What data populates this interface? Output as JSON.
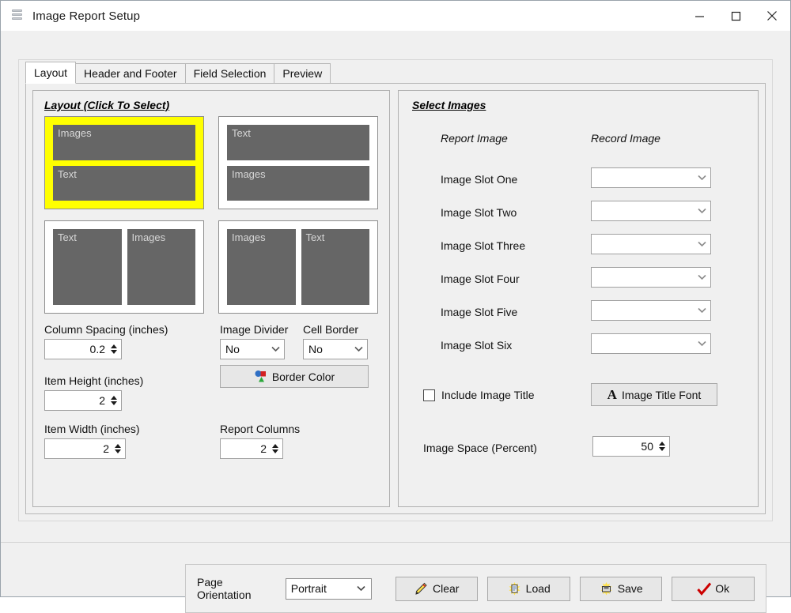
{
  "window": {
    "title": "Image Report Setup",
    "icon": "stacked-disks-icon",
    "minimize": "–",
    "maximize": "□",
    "close": "✕"
  },
  "tabs": [
    {
      "label": "Layout",
      "active": true
    },
    {
      "label": "Header and Footer",
      "active": false
    },
    {
      "label": "Field Selection",
      "active": false
    },
    {
      "label": "Preview",
      "active": false
    }
  ],
  "layout_panel": {
    "title": "Layout (Click To Select)",
    "tiles": [
      {
        "orientation": "rows",
        "cells": [
          "Images",
          "Text"
        ],
        "selected": true
      },
      {
        "orientation": "rows",
        "cells": [
          "Text",
          "Images"
        ],
        "selected": false
      },
      {
        "orientation": "cols",
        "cells": [
          "Text",
          "Images"
        ],
        "selected": false
      },
      {
        "orientation": "cols",
        "cells": [
          "Images",
          "Text"
        ],
        "selected": false
      }
    ],
    "fields": {
      "column_spacing_label": "Column Spacing (inches)",
      "column_spacing_value": "0.2",
      "item_height_label": "Item Height (inches)",
      "item_height_value": "2",
      "item_width_label": "Item Width (inches)",
      "item_width_value": "2",
      "image_divider_label": "Image Divider",
      "image_divider_value": "No",
      "cell_border_label": "Cell Border",
      "cell_border_value": "No",
      "border_color_button": "Border Color",
      "report_columns_label": "Report Columns",
      "report_columns_value": "2"
    }
  },
  "select_images_panel": {
    "title": "Select Images",
    "col_report_image": "Report Image",
    "col_record_image": "Record Image",
    "slots": [
      {
        "label": "Image Slot One",
        "value": ""
      },
      {
        "label": "Image Slot Two",
        "value": ""
      },
      {
        "label": "Image Slot Three",
        "value": ""
      },
      {
        "label": "Image Slot Four",
        "value": ""
      },
      {
        "label": "Image Slot Five",
        "value": ""
      },
      {
        "label": "Image Slot Six",
        "value": ""
      }
    ],
    "include_image_title_label": "Include Image Title",
    "include_image_title_checked": false,
    "image_title_font_button": "Image Title Font",
    "image_space_label": "Image Space (Percent)",
    "image_space_value": "50"
  },
  "bottom_bar": {
    "page_orientation_label": "Page Orientation",
    "page_orientation_value": "Portrait",
    "clear_button": "Clear",
    "load_button": "Load",
    "save_button": "Save",
    "ok_button": "Ok"
  },
  "colors": {
    "selected_tile": "#ffff00",
    "cell_block": "#666666",
    "window_bg": "#f0f0f0",
    "ok_check": "#cc0000"
  }
}
